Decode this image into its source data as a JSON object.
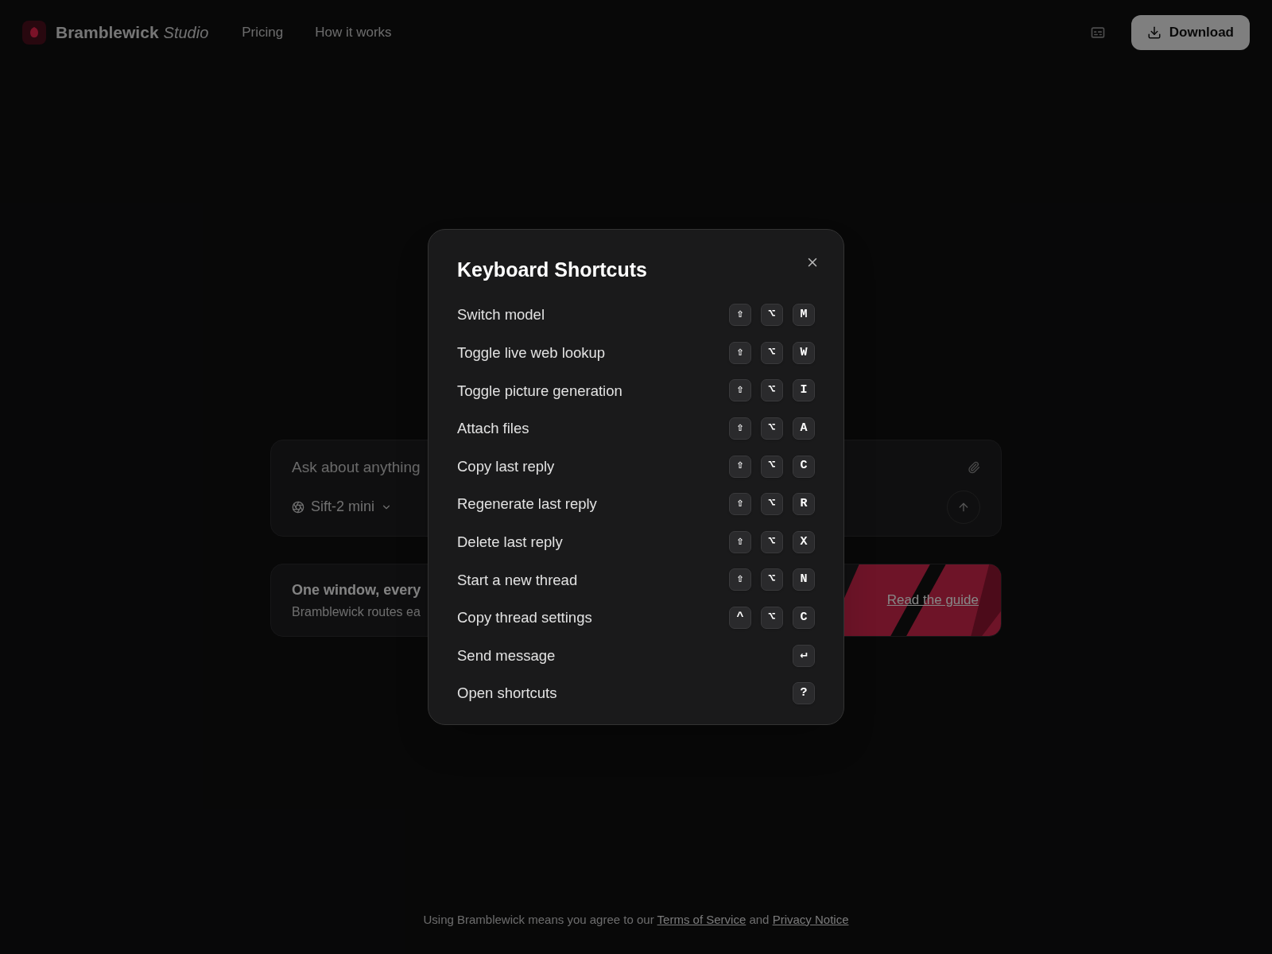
{
  "header": {
    "brand": "Bramblewick",
    "brand_suffix": "Studio",
    "nav": [
      "Pricing",
      "How it works"
    ],
    "download": "Download"
  },
  "composer": {
    "placeholder": "Ask about anything",
    "model": "Sift-2 mini"
  },
  "banner": {
    "title": "One window, every",
    "text": "Bramblewick routes ea",
    "link": "Read the guide"
  },
  "footer": {
    "text": "Using Bramblewick means you agree to our",
    "terms": "Terms of Service",
    "and": "and",
    "privacy": "Privacy Notice"
  },
  "dialog": {
    "title": "Keyboard Shortcuts",
    "shortcuts": [
      {
        "label": "Switch model",
        "keys": [
          "⇧",
          "⌥",
          "M"
        ]
      },
      {
        "label": "Toggle live web lookup",
        "keys": [
          "⇧",
          "⌥",
          "W"
        ]
      },
      {
        "label": "Toggle picture generation",
        "keys": [
          "⇧",
          "⌥",
          "I"
        ]
      },
      {
        "label": "Attach files",
        "keys": [
          "⇧",
          "⌥",
          "A"
        ]
      },
      {
        "label": "Copy last reply",
        "keys": [
          "⇧",
          "⌥",
          "C"
        ]
      },
      {
        "label": "Regenerate last reply",
        "keys": [
          "⇧",
          "⌥",
          "R"
        ]
      },
      {
        "label": "Delete last reply",
        "keys": [
          "⇧",
          "⌥",
          "X"
        ]
      },
      {
        "label": "Start a new thread",
        "keys": [
          "⇧",
          "⌥",
          "N"
        ]
      },
      {
        "label": "Copy thread settings",
        "keys": [
          "^",
          "⌥",
          "C"
        ]
      },
      {
        "label": "Send message",
        "keys": [
          "↵"
        ]
      },
      {
        "label": "Open shortcuts",
        "keys": [
          "?"
        ]
      }
    ]
  }
}
